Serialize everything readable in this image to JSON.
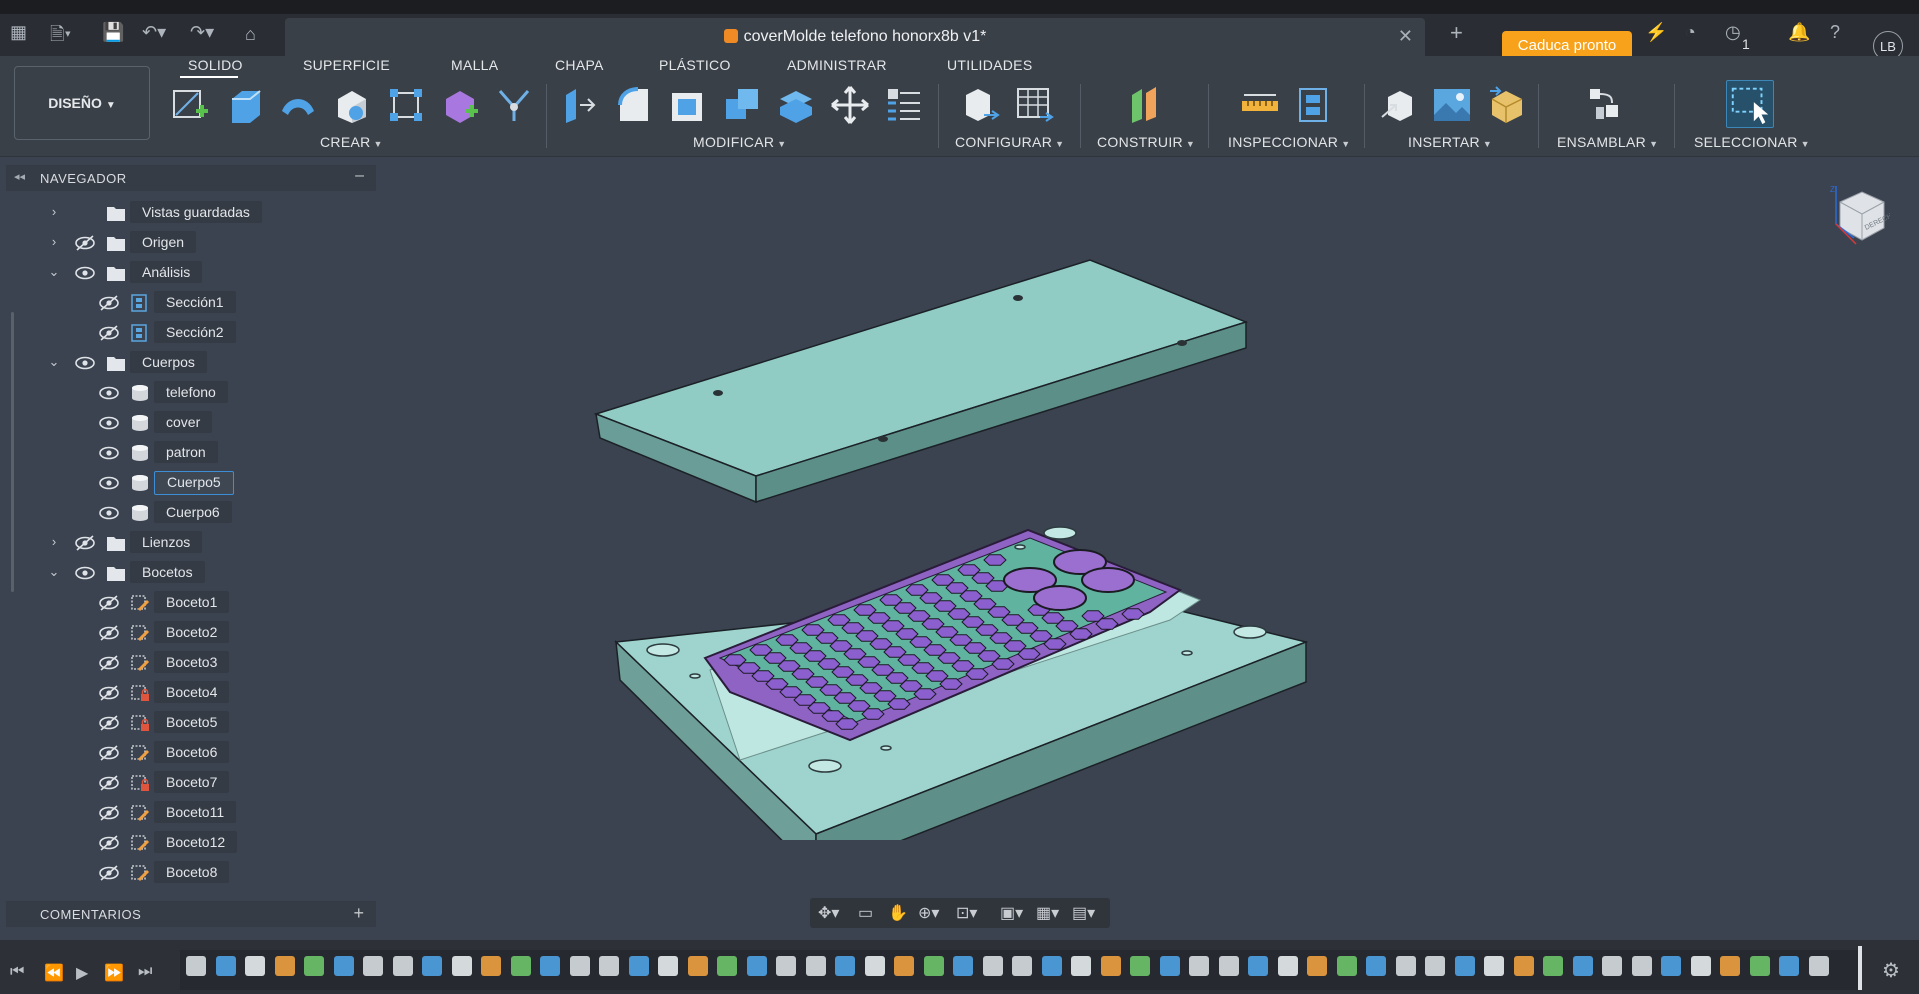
{
  "app": {
    "document_title": "coverMolde telefono honorx8b v1*",
    "expire_button": "Caduca pronto",
    "jobs_count": "1",
    "user_initials": "LB",
    "accent_color": "#f7a21a"
  },
  "ribbon": {
    "workspace_button": "DISEÑO",
    "tabs": [
      "SOLIDO",
      "SUPERFICIE",
      "MALLA",
      "CHAPA",
      "PLÁSTICO",
      "ADMINISTRAR",
      "UTILIDADES"
    ],
    "groups": [
      "CREAR",
      "MODIFICAR",
      "CONFIGURAR",
      "CONSTRUIR",
      "INSPECCIONAR",
      "INSERTAR",
      "ENSAMBLAR",
      "SELECCIONAR"
    ]
  },
  "navigator": {
    "title": "NAVEGADOR",
    "items": [
      {
        "label": "Vistas guardadas",
        "icon": "folder-icon",
        "visible": null,
        "chevron": "right"
      },
      {
        "label": "Origen",
        "icon": "folder-icon",
        "visible": false,
        "chevron": "right"
      },
      {
        "label": "Análisis",
        "icon": "folder-icon",
        "visible": true,
        "chevron": "down"
      },
      {
        "label": "Sección1",
        "icon": "section-analysis-icon",
        "visible": false,
        "chevron": ""
      },
      {
        "label": "Sección2",
        "icon": "section-analysis-icon",
        "visible": false,
        "chevron": ""
      },
      {
        "label": "Cuerpos",
        "icon": "folder-icon",
        "visible": true,
        "chevron": "down"
      },
      {
        "label": "telefono",
        "icon": "body-icon",
        "visible": true,
        "chevron": ""
      },
      {
        "label": "cover",
        "icon": "body-icon",
        "visible": true,
        "chevron": ""
      },
      {
        "label": "patron",
        "icon": "body-icon",
        "visible": true,
        "chevron": ""
      },
      {
        "label": "Cuerpo5",
        "icon": "body-icon",
        "visible": true,
        "chevron": "",
        "selected": true
      },
      {
        "label": "Cuerpo6",
        "icon": "body-icon",
        "visible": true,
        "chevron": ""
      },
      {
        "label": "Lienzos",
        "icon": "folder-icon",
        "visible": false,
        "chevron": "right"
      },
      {
        "label": "Bocetos",
        "icon": "folder-icon",
        "visible": true,
        "chevron": "down"
      },
      {
        "label": "Boceto1",
        "icon": "sketch-icon",
        "visible": false,
        "chevron": ""
      },
      {
        "label": "Boceto2",
        "icon": "sketch-icon",
        "visible": false,
        "chevron": ""
      },
      {
        "label": "Boceto3",
        "icon": "sketch-icon",
        "visible": false,
        "chevron": ""
      },
      {
        "label": "Boceto4",
        "icon": "sketch-locked-icon",
        "visible": false,
        "chevron": ""
      },
      {
        "label": "Boceto5",
        "icon": "sketch-locked-icon",
        "visible": false,
        "chevron": ""
      },
      {
        "label": "Boceto6",
        "icon": "sketch-icon",
        "visible": false,
        "chevron": ""
      },
      {
        "label": "Boceto7",
        "icon": "sketch-locked-icon",
        "visible": false,
        "chevron": ""
      },
      {
        "label": "Boceto11",
        "icon": "sketch-icon",
        "visible": false,
        "chevron": ""
      },
      {
        "label": "Boceto12",
        "icon": "sketch-icon",
        "visible": false,
        "chevron": ""
      },
      {
        "label": "Boceto8",
        "icon": "sketch-icon",
        "visible": false,
        "chevron": ""
      }
    ]
  },
  "comments": {
    "title": "COMENTARIOS"
  },
  "viewcube": {
    "face_label": "DERECHA",
    "axis_label": "Z"
  },
  "model": {
    "top_plate_color": "#8fcbc4",
    "base_color": "#a5d8d2",
    "cover_color": "#9b6fd0",
    "hex_pattern_color": "#4fae99"
  }
}
